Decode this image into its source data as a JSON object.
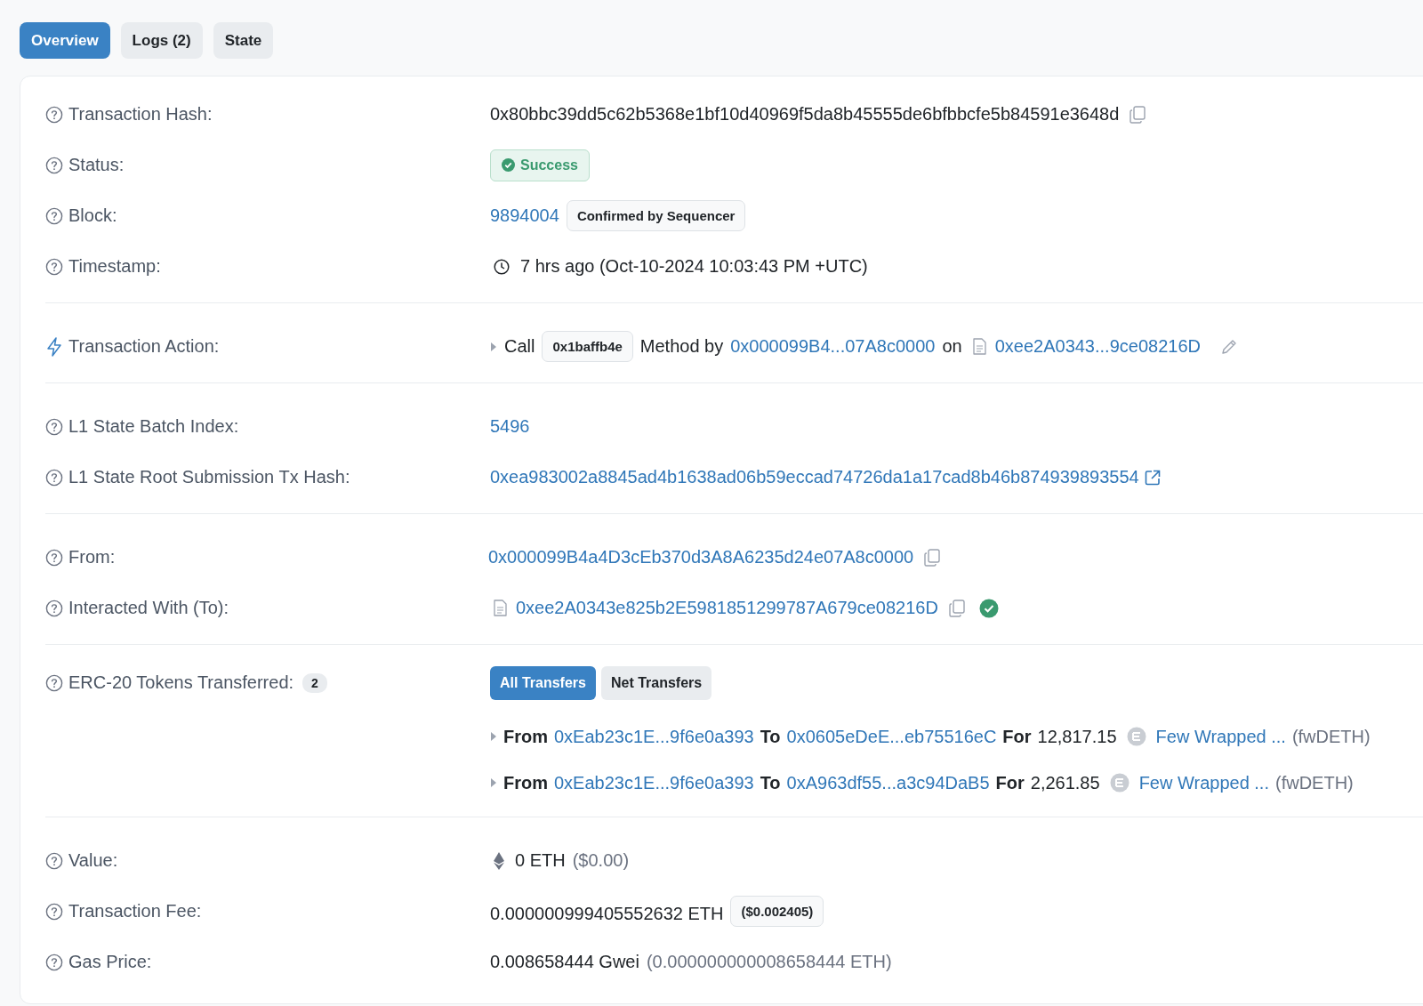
{
  "tabs": [
    {
      "label": "Overview",
      "selected": true
    },
    {
      "label": "Logs (2)",
      "selected": false
    },
    {
      "label": "State",
      "selected": false
    }
  ],
  "sections": [
    {
      "rows": [
        {
          "kind": "hash",
          "label": "Transaction Hash:",
          "text": "0x80bbc39dd5c62b5368e1bf10d40969f5da8b45555de6bfbbcfe5b84591e3648d"
        },
        {
          "kind": "status",
          "label": "Status:",
          "status": "Success"
        },
        {
          "kind": "block",
          "label": "Block:",
          "link": "9894004",
          "badge": "Confirmed by Sequencer"
        },
        {
          "kind": "timestamp",
          "label": "Timestamp:",
          "text": "7 hrs ago (Oct-10-2024 10:03:43 PM +UTC)"
        }
      ]
    },
    {
      "rows": [
        {
          "kind": "action",
          "label": "Transaction Action:",
          "verb": "Call",
          "method": "0x1baffb4e",
          "by_text": "Method by",
          "from": "0x000099B4...07A8c0000",
          "on_text": "on",
          "contract": "0xee2A0343...9ce08216D"
        }
      ]
    },
    {
      "rows": [
        {
          "kind": "link",
          "label": "L1 State Batch Index:",
          "link": "5496"
        },
        {
          "kind": "external",
          "label": "L1 State Root Submission Tx Hash:",
          "link": "0xea983002a8845ad4b1638ad06b59eccad74726da1a17cad8b46b874939893554"
        }
      ]
    },
    {
      "rows": [
        {
          "kind": "address",
          "label": "From:",
          "link": "0x000099B4a4D3cEb370d3A8A6235d24e07A8c0000",
          "contract": false,
          "verified": false
        },
        {
          "kind": "address",
          "label": "Interacted With (To):",
          "link": "0xee2A0343e825b2E5981851299787A679ce08216D",
          "contract": true,
          "verified": true
        }
      ]
    },
    {
      "rows": [
        {
          "kind": "tokens",
          "label": "ERC-20 Tokens Transferred:",
          "count": "2",
          "filters": [
            {
              "label": "All Transfers",
              "selected": true
            },
            {
              "label": "Net Transfers",
              "selected": false
            }
          ],
          "transfers": [
            {
              "from_text": "From",
              "from": "0xEab23c1E...9f6e0a393",
              "to_text": "To",
              "to": "0x0605eDeE...eb75516eC",
              "for_text": "For",
              "amount": "12,817.15",
              "token": "Few Wrapped ...",
              "symbol": "(fwDETH)"
            },
            {
              "from_text": "From",
              "from": "0xEab23c1E...9f6e0a393",
              "to_text": "To",
              "to": "0xA963df55...a3c94DaB5",
              "for_text": "For",
              "amount": "2,261.85",
              "token": "Few Wrapped ...",
              "symbol": "(fwDETH)"
            }
          ]
        }
      ]
    },
    {
      "rows": [
        {
          "kind": "value",
          "label": "Value:",
          "amount": "0 ETH",
          "usd": "($0.00)"
        },
        {
          "kind": "fee",
          "label": "Transaction Fee:",
          "amount": "0.000000999405552632 ETH",
          "usd": "($0.002405)"
        },
        {
          "kind": "gas",
          "label": "Gas Price:",
          "amount": "0.008658444 Gwei",
          "eth": "(0.000000000008658444 ETH)"
        }
      ]
    }
  ]
}
